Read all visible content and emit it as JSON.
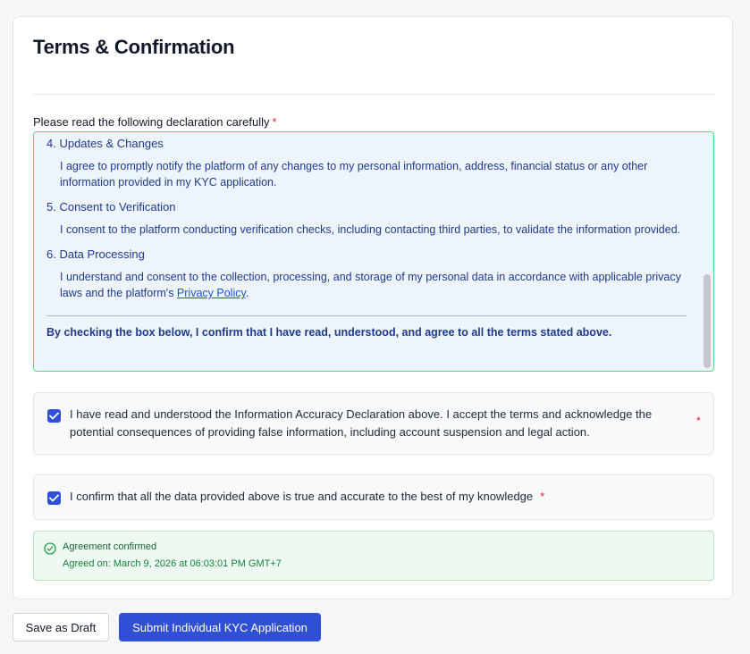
{
  "card": {
    "title": "Terms & Confirmation"
  },
  "declaration": {
    "label": "Please read the following declaration carefully",
    "required_mark": "*",
    "sections": [
      {
        "title": "4. Updates & Changes",
        "body": "I agree to promptly notify the platform of any changes to my personal information, address, financial status or any other information provided in my KYC application."
      },
      {
        "title": "5. Consent to Verification",
        "body": "I consent to the platform conducting verification checks, including contacting third parties, to validate the information provided."
      },
      {
        "title": "6. Data Processing",
        "body_prefix": "I understand and consent to the collection, processing, and storage of my personal data in accordance with applicable privacy laws and the platform's ",
        "link": "Privacy Policy",
        "body_suffix": "."
      }
    ],
    "confirm_text": "By checking the box below, I confirm that I have read, understood, and agree to all the terms stated above."
  },
  "checkboxes": [
    {
      "checked": true,
      "label": "I have read and understood the Information Accuracy Declaration above. I accept the terms and acknowledge the potential consequences of providing false information, including account suspension and legal action.",
      "required_mark": "*"
    },
    {
      "checked": true,
      "label": "I confirm that all the data provided above is true and accurate to the best of my knowledge",
      "required_mark": "*"
    }
  ],
  "agreement": {
    "icon": "check-circle-icon",
    "title": "Agreement confirmed",
    "subtitle": "Agreed on: March 9, 2026 at 06:03:01 PM GMT+7"
  },
  "actions": {
    "draft_label": "Save as Draft",
    "submit_label": "Submit Individual KYC Application"
  },
  "colors": {
    "primary": "#2f4fd4",
    "declaration_bg": "#eef4fc",
    "declaration_border": "#4ade80",
    "success_bg": "#eefaf1",
    "required": "#dc2626"
  }
}
